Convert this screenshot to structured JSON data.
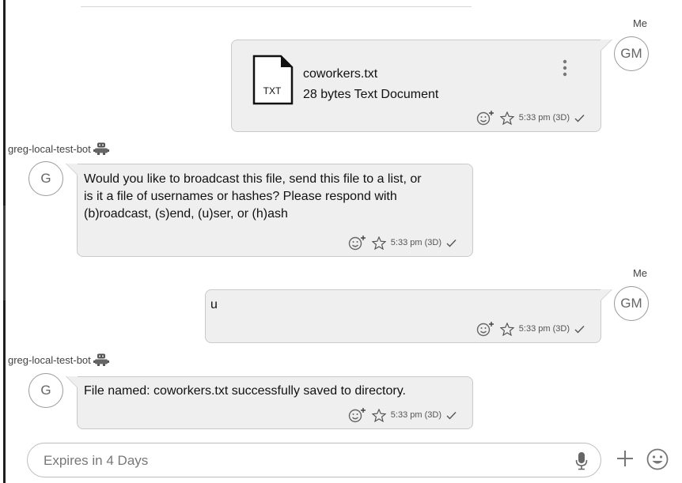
{
  "messages": [
    {
      "sender": "Me",
      "avatar": "GM",
      "type": "file",
      "file": {
        "icon_label": "TXT",
        "name": "coworkers.txt",
        "size": "28 bytes Text Document"
      },
      "timestamp": "5:33 pm (3D)"
    },
    {
      "sender": "greg-local-test-bot",
      "avatar": "G",
      "type": "text",
      "lines": [
        "Would you like to broadcast this file, send this file to a list, or",
        "is it a file of usernames or hashes? Please respond with",
        "(b)roadcast, (s)end, (u)ser, or (h)ash"
      ],
      "timestamp": "5:33 pm (3D)"
    },
    {
      "sender": "Me",
      "avatar": "GM",
      "type": "text",
      "lines": [
        "u"
      ],
      "timestamp": "5:33 pm (3D)"
    },
    {
      "sender": "greg-local-test-bot",
      "avatar": "G",
      "type": "text",
      "lines": [
        "File named: coworkers.txt successfully saved to directory."
      ],
      "timestamp": "5:33 pm (3D)"
    }
  ],
  "composer": {
    "placeholder": "Expires in 4 Days"
  },
  "icons": {
    "bot": "robot-icon",
    "reaction": "add-reaction-icon",
    "star": "star-icon",
    "check": "check-icon",
    "menu": "kebab-menu-icon",
    "mic": "microphone-icon",
    "attach": "plus-icon",
    "emoji": "emoji-icon"
  },
  "colors": {
    "bubble": "#efefef",
    "bubble_border": "#c9c9c9",
    "text": "#111111",
    "meta": "#555555"
  }
}
